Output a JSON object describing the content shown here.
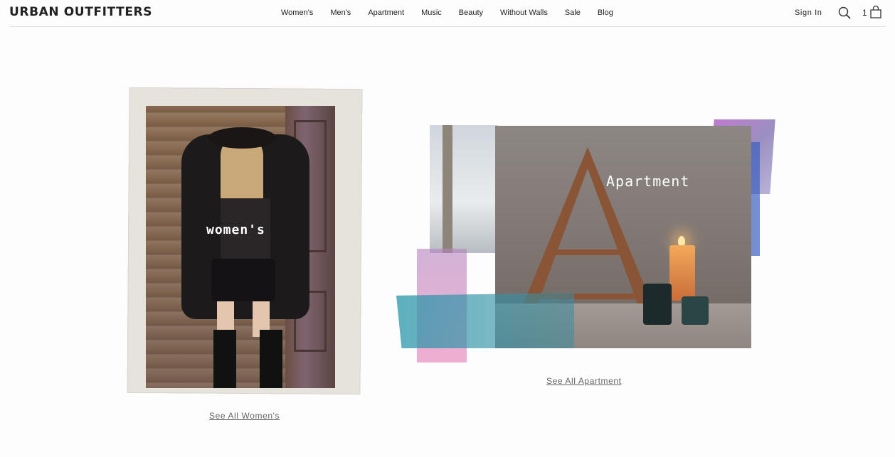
{
  "header": {
    "logo": "URBAN OUTFITTERS",
    "nav": [
      "Women's",
      "Men's",
      "Apartment",
      "Music",
      "Beauty",
      "Without Walls",
      "Sale",
      "Blog"
    ],
    "sign_in": "Sign In",
    "cart_count": "1",
    "search_icon": "search-icon",
    "bag_icon": "shopping-bag-icon"
  },
  "cards": {
    "women": {
      "image_label": "women's",
      "link": "See All Women's"
    },
    "apartment": {
      "image_label": "Apartment",
      "link": "See All Apartment"
    }
  },
  "colors": {
    "text": "#222222",
    "link": "#666666",
    "background": "#fdfdfd"
  }
}
